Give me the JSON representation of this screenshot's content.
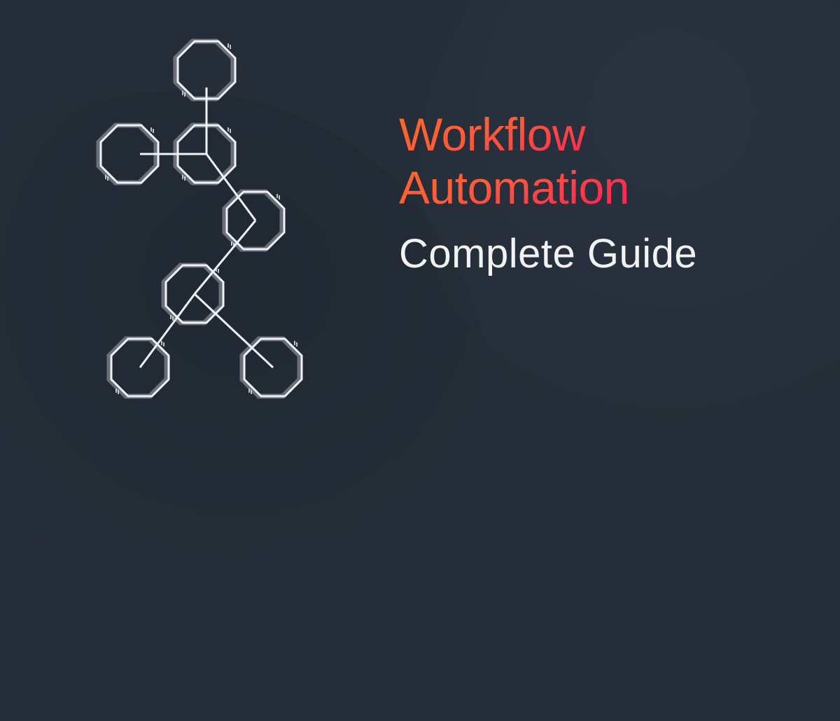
{
  "title": {
    "line1": "Workflow",
    "line2": "Automation"
  },
  "subtitle": "Complete Guide",
  "colors": {
    "bg": "#252d38",
    "gradient_start": "#ff6a2b",
    "gradient_end": "#ff1e5e",
    "icon_stroke": "#f0f2f5"
  },
  "icon": {
    "name": "workflow-graph",
    "nodes": 7
  }
}
